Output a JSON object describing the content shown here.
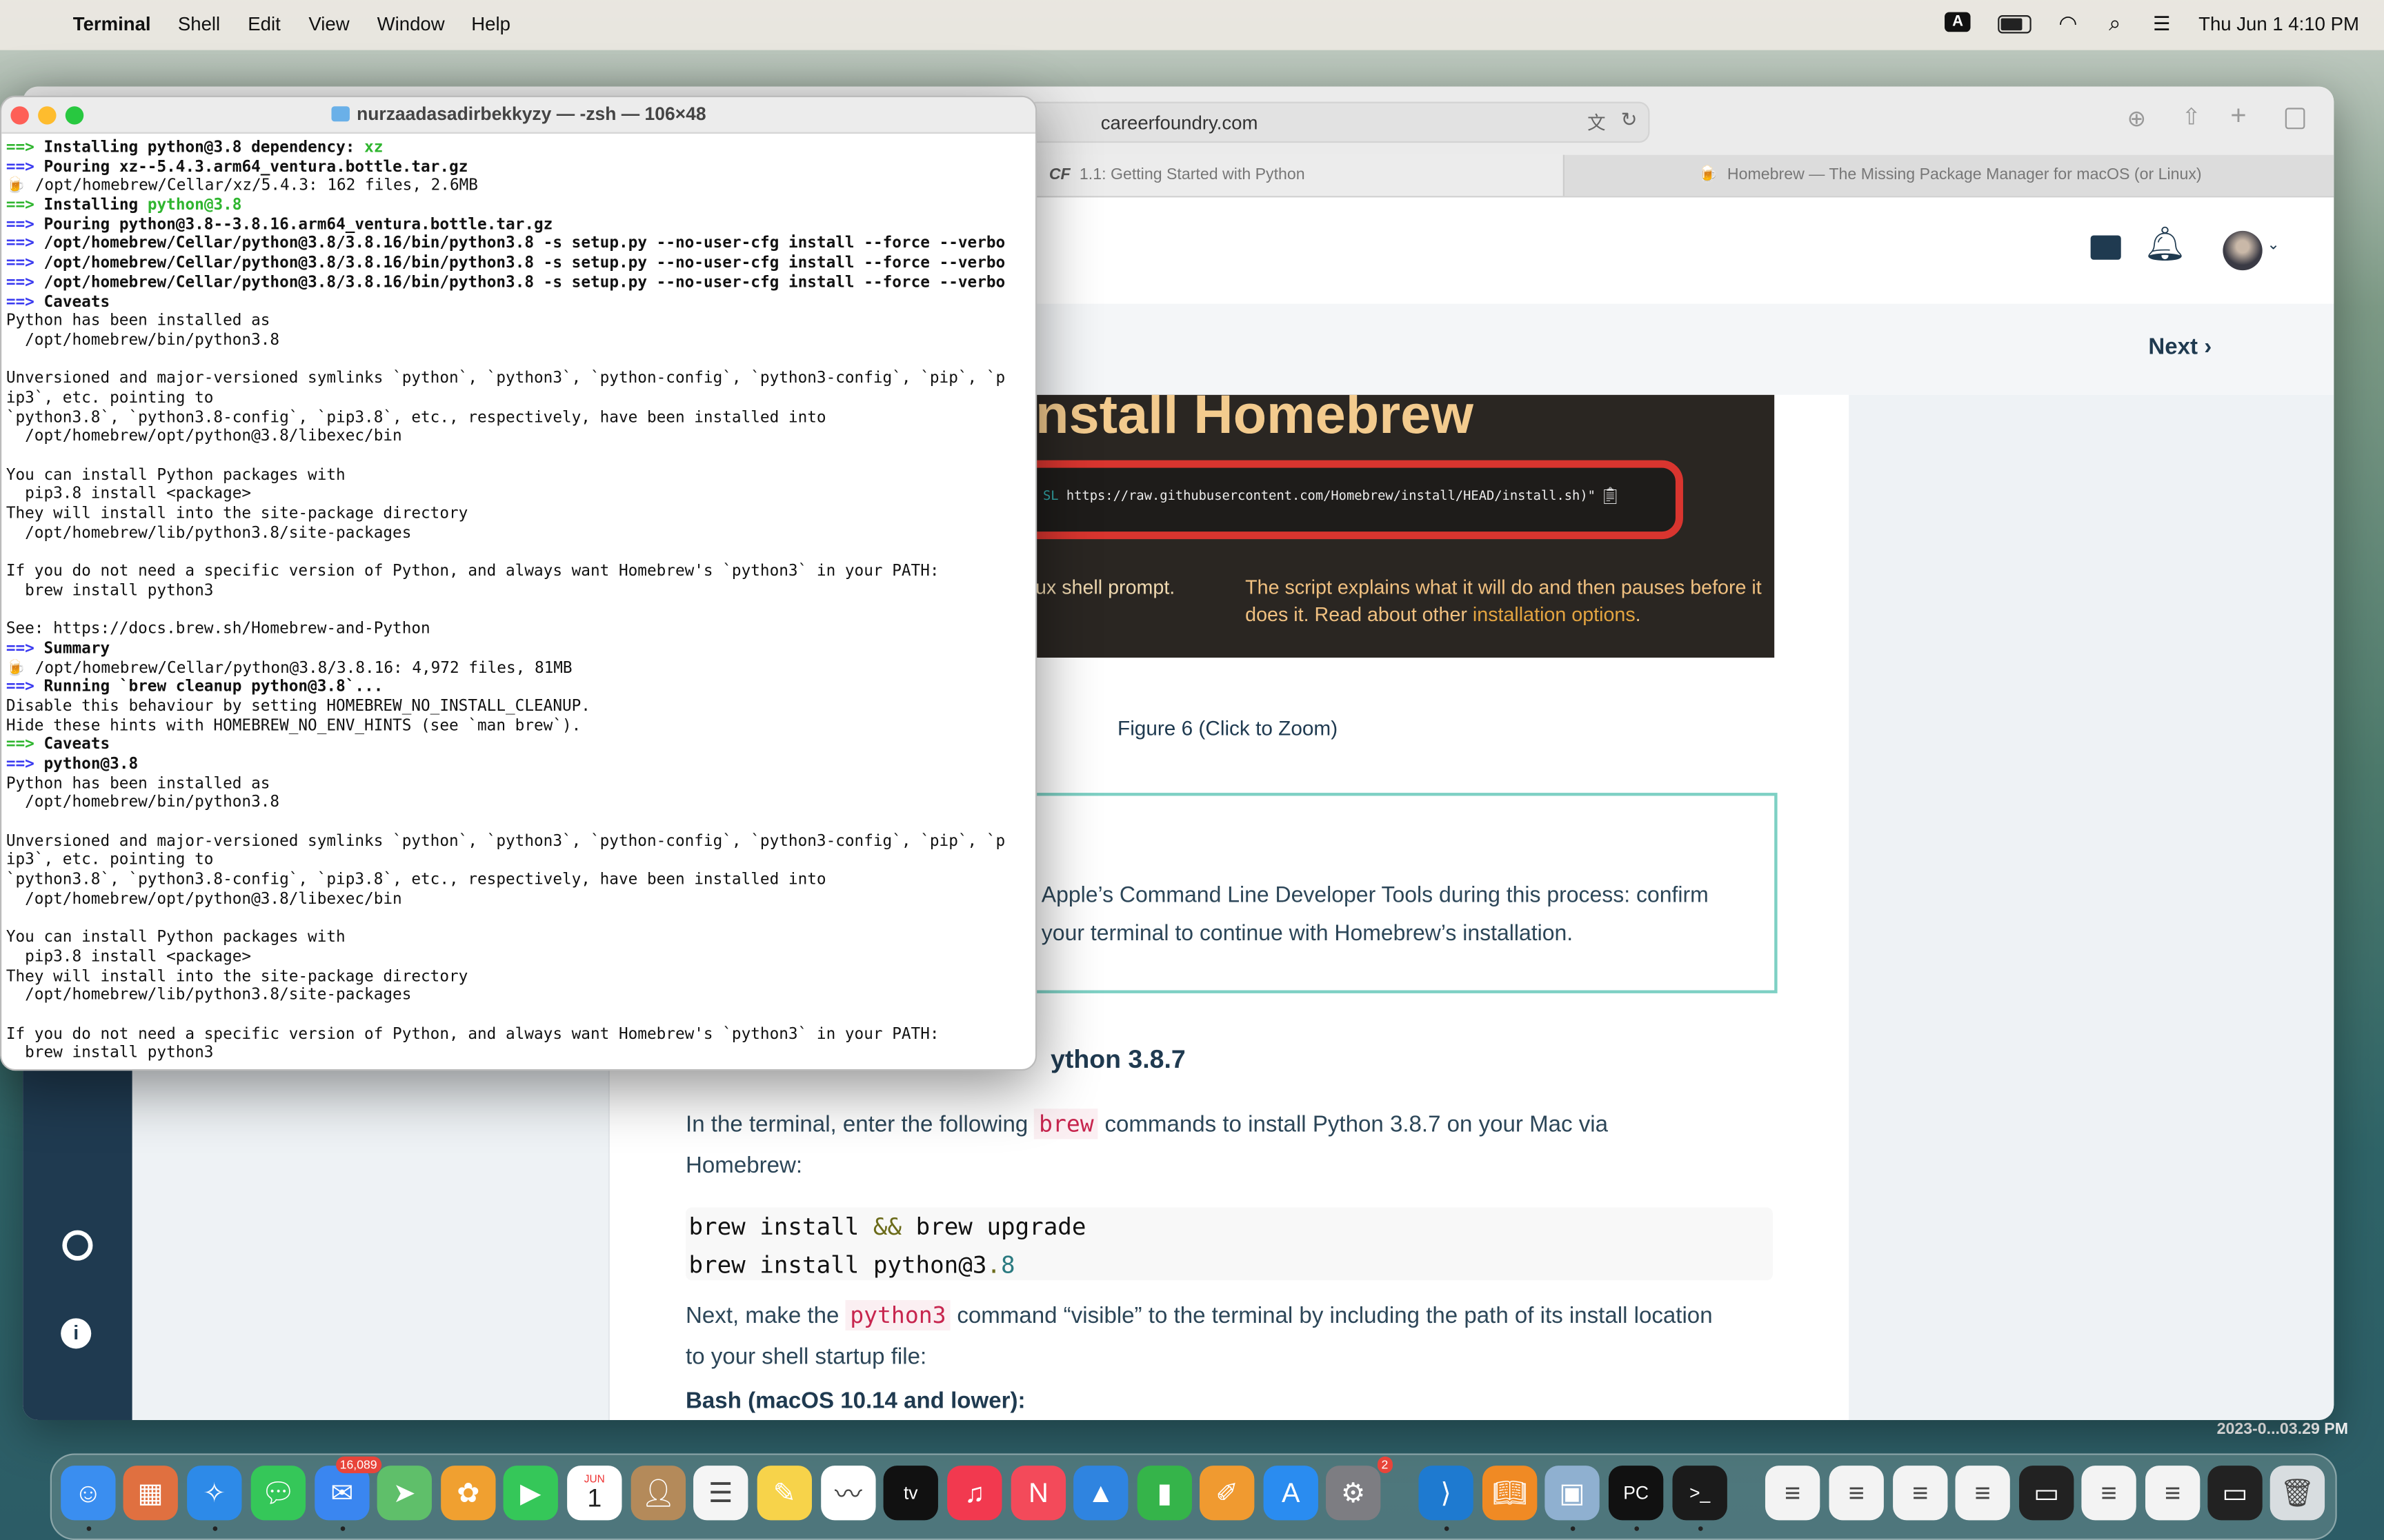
{
  "menubar": {
    "app": "Terminal",
    "items": [
      "Shell",
      "Edit",
      "View",
      "Window",
      "Help"
    ],
    "input_badge": "A",
    "datetime": "Thu Jun 1  4:10 PM"
  },
  "browser": {
    "url": "careerfoundry.com",
    "tabs": [
      {
        "label": "1.1: Getting Started with Python",
        "icon": "CF",
        "active": false
      },
      {
        "label": "Homebrew — The Missing Package Manager for macOS (or Linux)",
        "active": true
      }
    ],
    "next_label": "Next",
    "figure": {
      "title": "nstall Homebrew",
      "command": "https://raw.githubusercontent.com/Homebrew/install/HEAD/install.sh)\"",
      "command_prefix": "SL",
      "left_text": "ux shell prompt.",
      "right_text": "The script explains what it will do and then pauses before it does it. Read about other ",
      "right_link": "installation options",
      "right_end": "."
    },
    "figure_caption": "Figure 6 (Click to Zoom)",
    "note_lines": [
      "Apple’s Command Line Developer Tools during this process: confirm",
      "your terminal to continue with Homebrew’s installation."
    ],
    "heading": "ython 3.8.7",
    "para1": {
      "before": "In the terminal, enter the following ",
      "code": "brew",
      "after": " commands to install Python 3.8.7 on your Mac via",
      "line2": "Homebrew:"
    },
    "code_lines": [
      [
        "brew install ",
        "&&",
        " brew upgrade"
      ],
      [
        "brew install python@3",
        ".",
        "8"
      ]
    ],
    "para2": {
      "before": "Next, make the ",
      "code": "python3",
      "after": " command “visible” to the terminal by including the path of its install location",
      "line2": "to your shell startup file:"
    },
    "subheading": "Bash (macOS 10.14 and lower):"
  },
  "terminal": {
    "title": "nurzaadasadirbekkyzy — -zsh — 106×48",
    "lines": [
      {
        "p": "==>",
        "pc": "g",
        "t": "Installing python@3.8 dependency: ",
        "b": true,
        "h": "xz"
      },
      {
        "p": "==>",
        "pc": "b",
        "t": "Pouring xz--5.4.3.arm64_ventura.bottle.tar.gz",
        "b": true
      },
      {
        "p": "🍺",
        "pc": "",
        "t": "/opt/homebrew/Cellar/xz/5.4.3: 162 files, 2.6MB"
      },
      {
        "p": "==>",
        "pc": "g",
        "t": "Installing ",
        "b": true,
        "h": "python@3.8"
      },
      {
        "p": "==>",
        "pc": "b",
        "t": "Pouring python@3.8--3.8.16.arm64_ventura.bottle.tar.gz",
        "b": true
      },
      {
        "p": "==>",
        "pc": "b",
        "t": "/opt/homebrew/Cellar/python@3.8/3.8.16/bin/python3.8 -s setup.py --no-user-cfg install --force --verbo",
        "b": true
      },
      {
        "p": "==>",
        "pc": "b",
        "t": "/opt/homebrew/Cellar/python@3.8/3.8.16/bin/python3.8 -s setup.py --no-user-cfg install --force --verbo",
        "b": true
      },
      {
        "p": "==>",
        "pc": "b",
        "t": "/opt/homebrew/Cellar/python@3.8/3.8.16/bin/python3.8 -s setup.py --no-user-cfg install --force --verbo",
        "b": true
      },
      {
        "p": "==>",
        "pc": "b",
        "t": "Caveats",
        "b": true
      },
      {
        "t": "Python has been installed as"
      },
      {
        "t": "  /opt/homebrew/bin/python3.8"
      },
      {
        "t": ""
      },
      {
        "t": "Unversioned and major-versioned symlinks `python`, `python3`, `python-config`, `python3-config`, `pip`, `p"
      },
      {
        "t": "ip3`, etc. pointing to"
      },
      {
        "t": "`python3.8`, `python3.8-config`, `pip3.8`, etc., respectively, have been installed into"
      },
      {
        "t": "  /opt/homebrew/opt/python@3.8/libexec/bin"
      },
      {
        "t": ""
      },
      {
        "t": "You can install Python packages with"
      },
      {
        "t": "  pip3.8 install <package>"
      },
      {
        "t": "They will install into the site-package directory"
      },
      {
        "t": "  /opt/homebrew/lib/python3.8/site-packages"
      },
      {
        "t": ""
      },
      {
        "t": "If you do not need a specific version of Python, and always want Homebrew's `python3` in your PATH:"
      },
      {
        "t": "  brew install python3"
      },
      {
        "t": ""
      },
      {
        "t": "See: https://docs.brew.sh/Homebrew-and-Python"
      },
      {
        "p": "==>",
        "pc": "b",
        "t": "Summary",
        "b": true
      },
      {
        "p": "🍺",
        "pc": "",
        "t": "/opt/homebrew/Cellar/python@3.8/3.8.16: 4,972 files, 81MB"
      },
      {
        "p": "==>",
        "pc": "b",
        "t": "Running `brew cleanup python@3.8`...",
        "b": true
      },
      {
        "t": "Disable this behaviour by setting HOMEBREW_NO_INSTALL_CLEANUP."
      },
      {
        "t": "Hide these hints with HOMEBREW_NO_ENV_HINTS (see `man brew`)."
      },
      {
        "p": "==>",
        "pc": "g",
        "t": "Caveats",
        "b": true
      },
      {
        "p": "==>",
        "pc": "b",
        "t": "python@3.8",
        "b": true
      },
      {
        "t": "Python has been installed as"
      },
      {
        "t": "  /opt/homebrew/bin/python3.8"
      },
      {
        "t": ""
      },
      {
        "t": "Unversioned and major-versioned symlinks `python`, `python3`, `python-config`, `python3-config`, `pip`, `p"
      },
      {
        "t": "ip3`, etc. pointing to"
      },
      {
        "t": "`python3.8`, `python3.8-config`, `pip3.8`, etc., respectively, have been installed into"
      },
      {
        "t": "  /opt/homebrew/opt/python@3.8/libexec/bin"
      },
      {
        "t": ""
      },
      {
        "t": "You can install Python packages with"
      },
      {
        "t": "  pip3.8 install <package>"
      },
      {
        "t": "They will install into the site-package directory"
      },
      {
        "t": "  /opt/homebrew/lib/python3.8/site-packages"
      },
      {
        "t": ""
      },
      {
        "t": "If you do not need a specific version of Python, and always want Homebrew's `python3` in your PATH:"
      },
      {
        "t": "  brew install python3"
      }
    ]
  },
  "desktop": {
    "widget_label": "2023-0...03.29 PM"
  },
  "dock": [
    {
      "icon": "finder",
      "color": "#3a8ef0"
    },
    {
      "icon": "launchpad",
      "color": "#e07040"
    },
    {
      "icon": "safari",
      "color": "#2d8ae8"
    },
    {
      "icon": "messages",
      "color": "#35c759"
    },
    {
      "icon": "mail",
      "color": "#3a86f0",
      "badge": "16,089"
    },
    {
      "icon": "maps",
      "color": "#5fbf6a"
    },
    {
      "icon": "photos",
      "color": "#f0a030"
    },
    {
      "icon": "facetime",
      "color": "#35c759"
    },
    {
      "icon": "calendar",
      "color": "#ffffff",
      "month": "JUN",
      "day": "1"
    },
    {
      "icon": "contacts",
      "color": "#b48a5a"
    },
    {
      "icon": "reminders",
      "color": "#f5f5f5"
    },
    {
      "icon": "notes",
      "color": "#f7d34a"
    },
    {
      "icon": "freeform",
      "color": "#ffffff"
    },
    {
      "icon": "tv",
      "color": "#111111"
    },
    {
      "icon": "music",
      "color": "#f2394f"
    },
    {
      "icon": "news",
      "color": "#f34a5a"
    },
    {
      "icon": "keynote",
      "color": "#2f84e0"
    },
    {
      "icon": "numbers",
      "color": "#35b44a"
    },
    {
      "icon": "pages",
      "color": "#f09a30"
    },
    {
      "icon": "app-store",
      "color": "#2a8cf0"
    },
    {
      "icon": "system-settings",
      "color": "#7d7d82",
      "badge": "2"
    },
    {
      "icon": "vscode",
      "color": "#1e7ad0"
    },
    {
      "icon": "books",
      "color": "#f08a24"
    },
    {
      "icon": "preview",
      "color": "#8fb0d0"
    },
    {
      "icon": "pycharm",
      "color": "#111111"
    },
    {
      "icon": "terminal-app",
      "color": "#1b1b1b"
    },
    {
      "icon": "document",
      "color": "#f3f3f3"
    },
    {
      "icon": "document",
      "color": "#f3f3f3"
    },
    {
      "icon": "document",
      "color": "#f3f3f3"
    },
    {
      "icon": "document",
      "color": "#f3f3f3"
    },
    {
      "icon": "window",
      "color": "#222222"
    },
    {
      "icon": "document",
      "color": "#f3f3f3"
    },
    {
      "icon": "document",
      "color": "#f3f3f3"
    },
    {
      "icon": "window",
      "color": "#222222"
    },
    {
      "icon": "trash",
      "color": "#d8dde0"
    }
  ]
}
